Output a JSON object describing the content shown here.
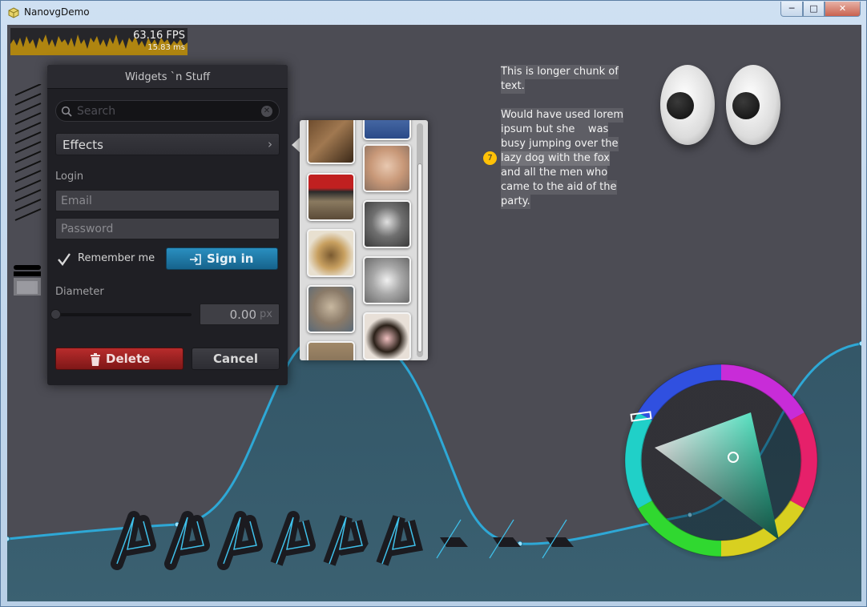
{
  "window": {
    "title": "NanovgDemo",
    "controls": {
      "minimize": "─",
      "maximize": "□",
      "close": "✕"
    }
  },
  "fps": {
    "value": "63.16 FPS",
    "ms": "15.83 ms"
  },
  "panel": {
    "title": "Widgets `n Stuff",
    "search": {
      "placeholder": "Search",
      "value": ""
    },
    "effects": {
      "label": "Effects"
    },
    "login": {
      "label": "Login",
      "email_placeholder": "Email",
      "password_placeholder": "Password",
      "remember_label": "Remember me",
      "remember_checked": true,
      "signin_label": "Sign in"
    },
    "diameter": {
      "label": "Diameter",
      "value": "0.00",
      "unit": "px",
      "slider_fraction": 0.0
    },
    "buttons": {
      "delete_label": "Delete",
      "cancel_label": "Cancel"
    }
  },
  "thumbnails": {
    "icons": [
      "shrew-photo",
      "goldfish-photo",
      "bunny-photo",
      "pirate-kitten-photo",
      "ferret-photo",
      "tortoise-photo",
      "mouse-photo",
      "seal-photo",
      "pig-photo",
      "partial-photo"
    ]
  },
  "paragraph": {
    "lines": [
      "This is longer chunk of",
      "text.",
      "",
      "Would have used lorem",
      "ipsum but she    was",
      "busy jumping over the",
      "lazy dog with the fox",
      "and all the men who",
      "came to the aid of the",
      "party."
    ],
    "line_badge": "7"
  },
  "colors": {
    "background": "#4c4c54",
    "accent": "#2ea8d6",
    "signin": "#1e7aa8",
    "delete": "#9e2323",
    "badge": "#ffc107",
    "fps_graph": "#c8960c"
  }
}
